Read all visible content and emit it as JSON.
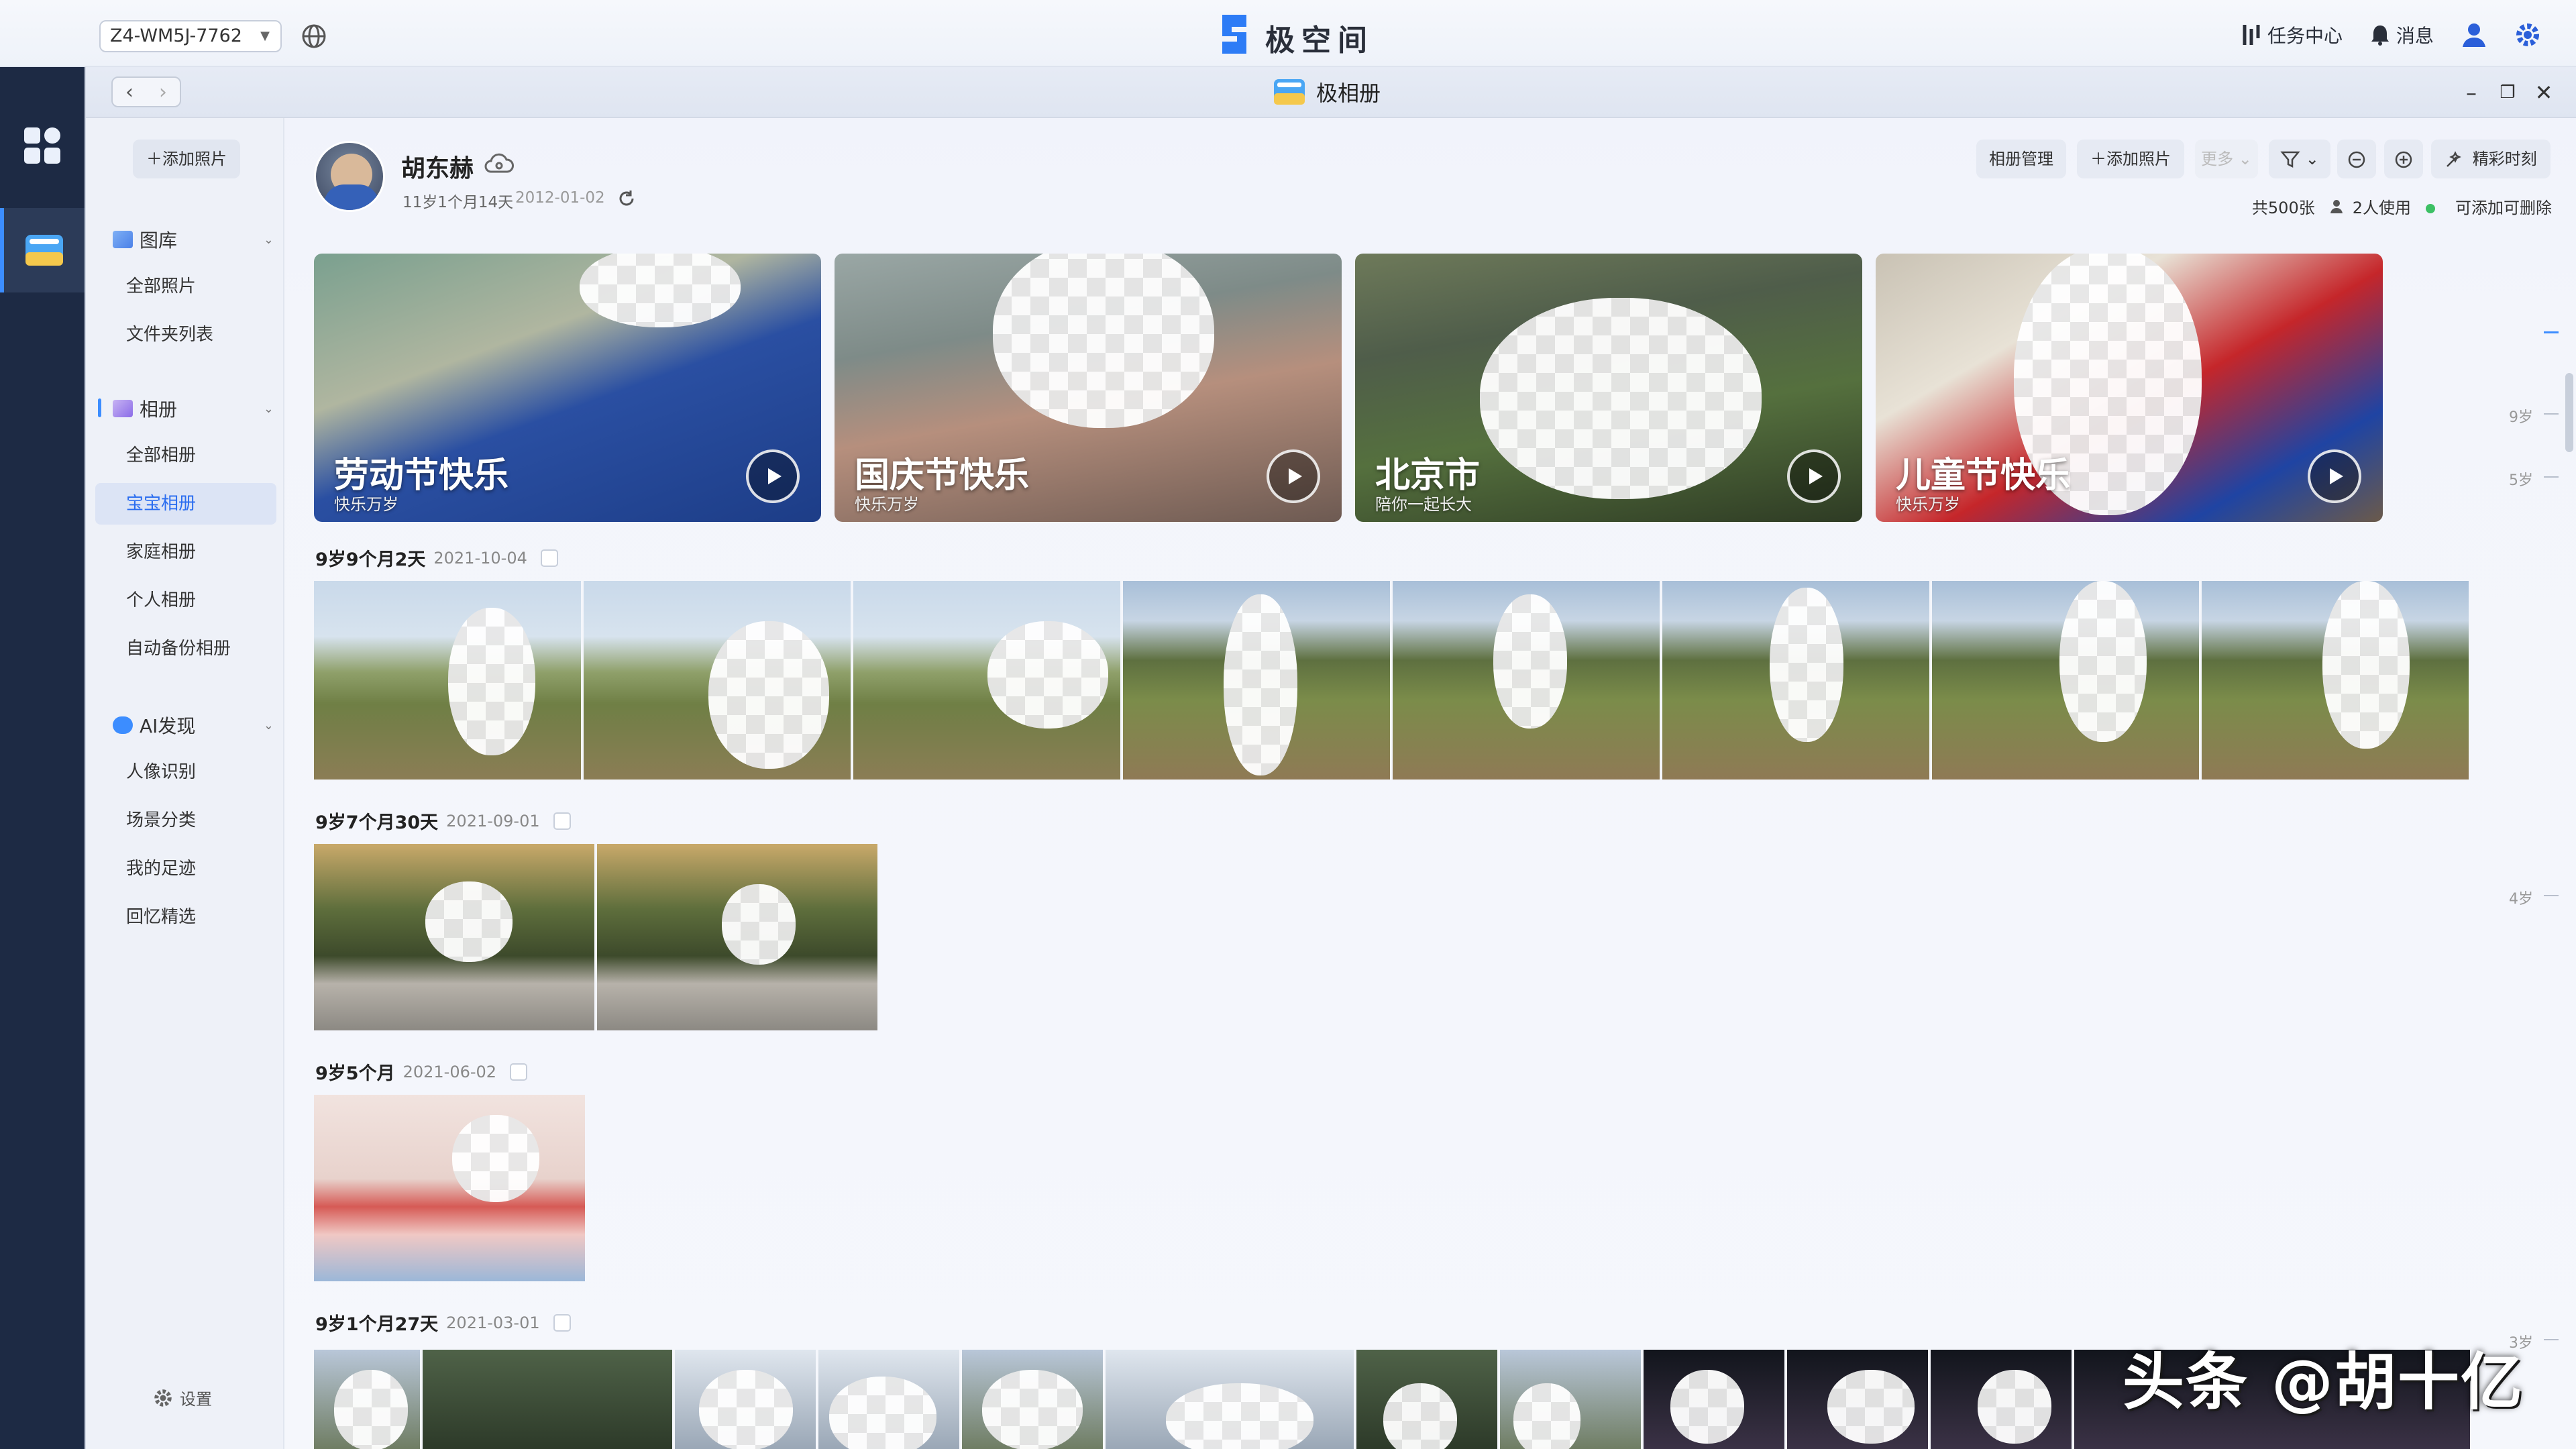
{
  "topbar": {
    "device": "Z4-WM5J-7762",
    "app_title": "极空间",
    "task_center": "任务中心",
    "messages": "消息"
  },
  "window": {
    "title": "极相册"
  },
  "sidebar": {
    "add_photo": "添加照片",
    "gallery": {
      "label": "图库",
      "items": [
        "全部照片",
        "文件夹列表"
      ]
    },
    "albums": {
      "label": "相册",
      "items": [
        "全部相册",
        "宝宝相册",
        "家庭相册",
        "个人相册",
        "自动备份相册"
      ],
      "active": "宝宝相册"
    },
    "ai": {
      "label": "AI发现",
      "items": [
        "人像识别",
        "场景分类",
        "我的足迹",
        "回忆精选"
      ]
    },
    "settings": "设置"
  },
  "profile": {
    "name": "胡东赫",
    "age": "11岁1个月14天",
    "birth": "2012-01-02"
  },
  "toolbar": {
    "manage": "相册管理",
    "add_photo": "添加照片",
    "more": "更多",
    "highlights": "精彩时刻"
  },
  "stats": {
    "total": "共500张",
    "users": "2人使用",
    "deletable": "可添加可删除"
  },
  "featured": [
    {
      "title": "劳动节快乐",
      "subtitle": "快乐万岁"
    },
    {
      "title": "国庆节快乐",
      "subtitle": "快乐万岁"
    },
    {
      "title": "北京市",
      "subtitle": "陪你一起长大"
    },
    {
      "title": "儿童节快乐",
      "subtitle": "快乐万岁"
    }
  ],
  "groups": [
    {
      "title": "9岁9个月2天",
      "date": "2021-10-04"
    },
    {
      "title": "9岁7个月30天",
      "date": "2021-09-01"
    },
    {
      "title": "9岁5个月",
      "date": "2021-06-02"
    },
    {
      "title": "9岁1个月27天",
      "date": "2021-03-01"
    }
  ],
  "timeline": [
    "9岁",
    "5岁",
    "4岁",
    "3岁"
  ],
  "watermark": "头条 @胡十亿"
}
